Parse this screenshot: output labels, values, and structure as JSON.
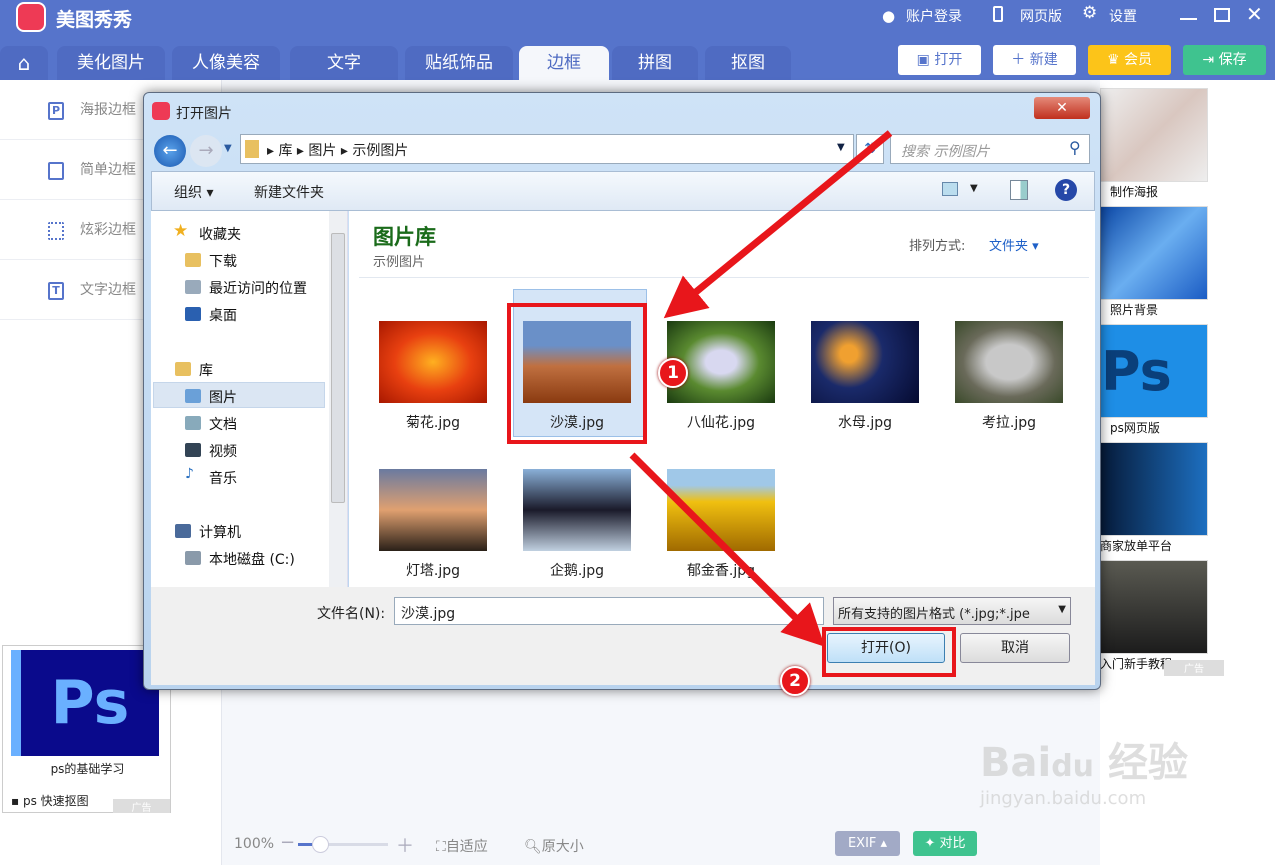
{
  "app": {
    "title": "美图秀秀",
    "top_links": [
      "账户登录",
      "网页版",
      "设置"
    ]
  },
  "tabs": [
    {
      "label": "美化图片"
    },
    {
      "label": "人像美容"
    },
    {
      "label": "文字"
    },
    {
      "label": "贴纸饰品"
    },
    {
      "label": "边框",
      "active": true
    },
    {
      "label": "拼图"
    },
    {
      "label": "抠图"
    }
  ],
  "actions": {
    "open": "打开",
    "new": "新建",
    "vip": "会员",
    "save": "保存"
  },
  "sidebar": {
    "items": [
      {
        "label": "海报边框",
        "icon": "P"
      },
      {
        "label": "简单边框",
        "icon": ""
      },
      {
        "label": "炫彩边框",
        "icon": ""
      },
      {
        "label": "文字边框",
        "icon": "T"
      }
    ]
  },
  "left_ad": {
    "caption": "ps的基础学习",
    "link": "ps 快速抠图",
    "ad_label": "广告"
  },
  "right_ads": [
    {
      "label": "制作海报"
    },
    {
      "label": "照片背景"
    },
    {
      "label": "ps网页版"
    },
    {
      "label": "商家放单平台"
    },
    {
      "label": "入门新手教程"
    }
  ],
  "right_ad_label": "广告",
  "dialog": {
    "title": "打开图片",
    "breadcrumb": [
      "库",
      "图片",
      "示例图片"
    ],
    "search_placeholder": "搜索 示例图片",
    "toolbar": {
      "organize": "组织 ▾",
      "new_folder": "新建文件夹"
    },
    "nav": {
      "favorites": "收藏夹",
      "fav_items": [
        "下载",
        "最近访问的位置",
        "桌面"
      ],
      "libraries": "库",
      "lib_items": [
        "图片",
        "文档",
        "视频",
        "音乐"
      ],
      "computer": "计算机",
      "comp_items": [
        "本地磁盘 (C:)"
      ]
    },
    "library_title": "图片库",
    "library_sub": "示例图片",
    "sort_label": "排列方式:",
    "sort_value": "文件夹",
    "files": [
      {
        "name": "菊花.jpg"
      },
      {
        "name": "沙漠.jpg",
        "selected": true
      },
      {
        "name": "八仙花.jpg"
      },
      {
        "name": "水母.jpg"
      },
      {
        "name": "考拉.jpg"
      },
      {
        "name": "灯塔.jpg"
      },
      {
        "name": "企鹅.jpg"
      },
      {
        "name": "郁金香.jpg"
      }
    ],
    "filename_label": "文件名(N):",
    "filename_value": "沙漠.jpg",
    "filetype": "所有支持的图片格式 (*.jpg;*.jpe",
    "open_button": "打开(O)",
    "cancel_button": "取消"
  },
  "annotations": [
    "1",
    "2"
  ],
  "bottom": {
    "zoom": "100%",
    "fit": "自适应",
    "original": "原大小",
    "exif": "EXIF ▴",
    "compare": "对比"
  },
  "zoom_level_fraction": 0.15,
  "watermark": "Bai du 经验 jingyan.baidu.com",
  "colors": {
    "brand": "#5674cb",
    "vip": "#fcc419",
    "save": "#3fc38f",
    "annotation": "#e8161b"
  }
}
